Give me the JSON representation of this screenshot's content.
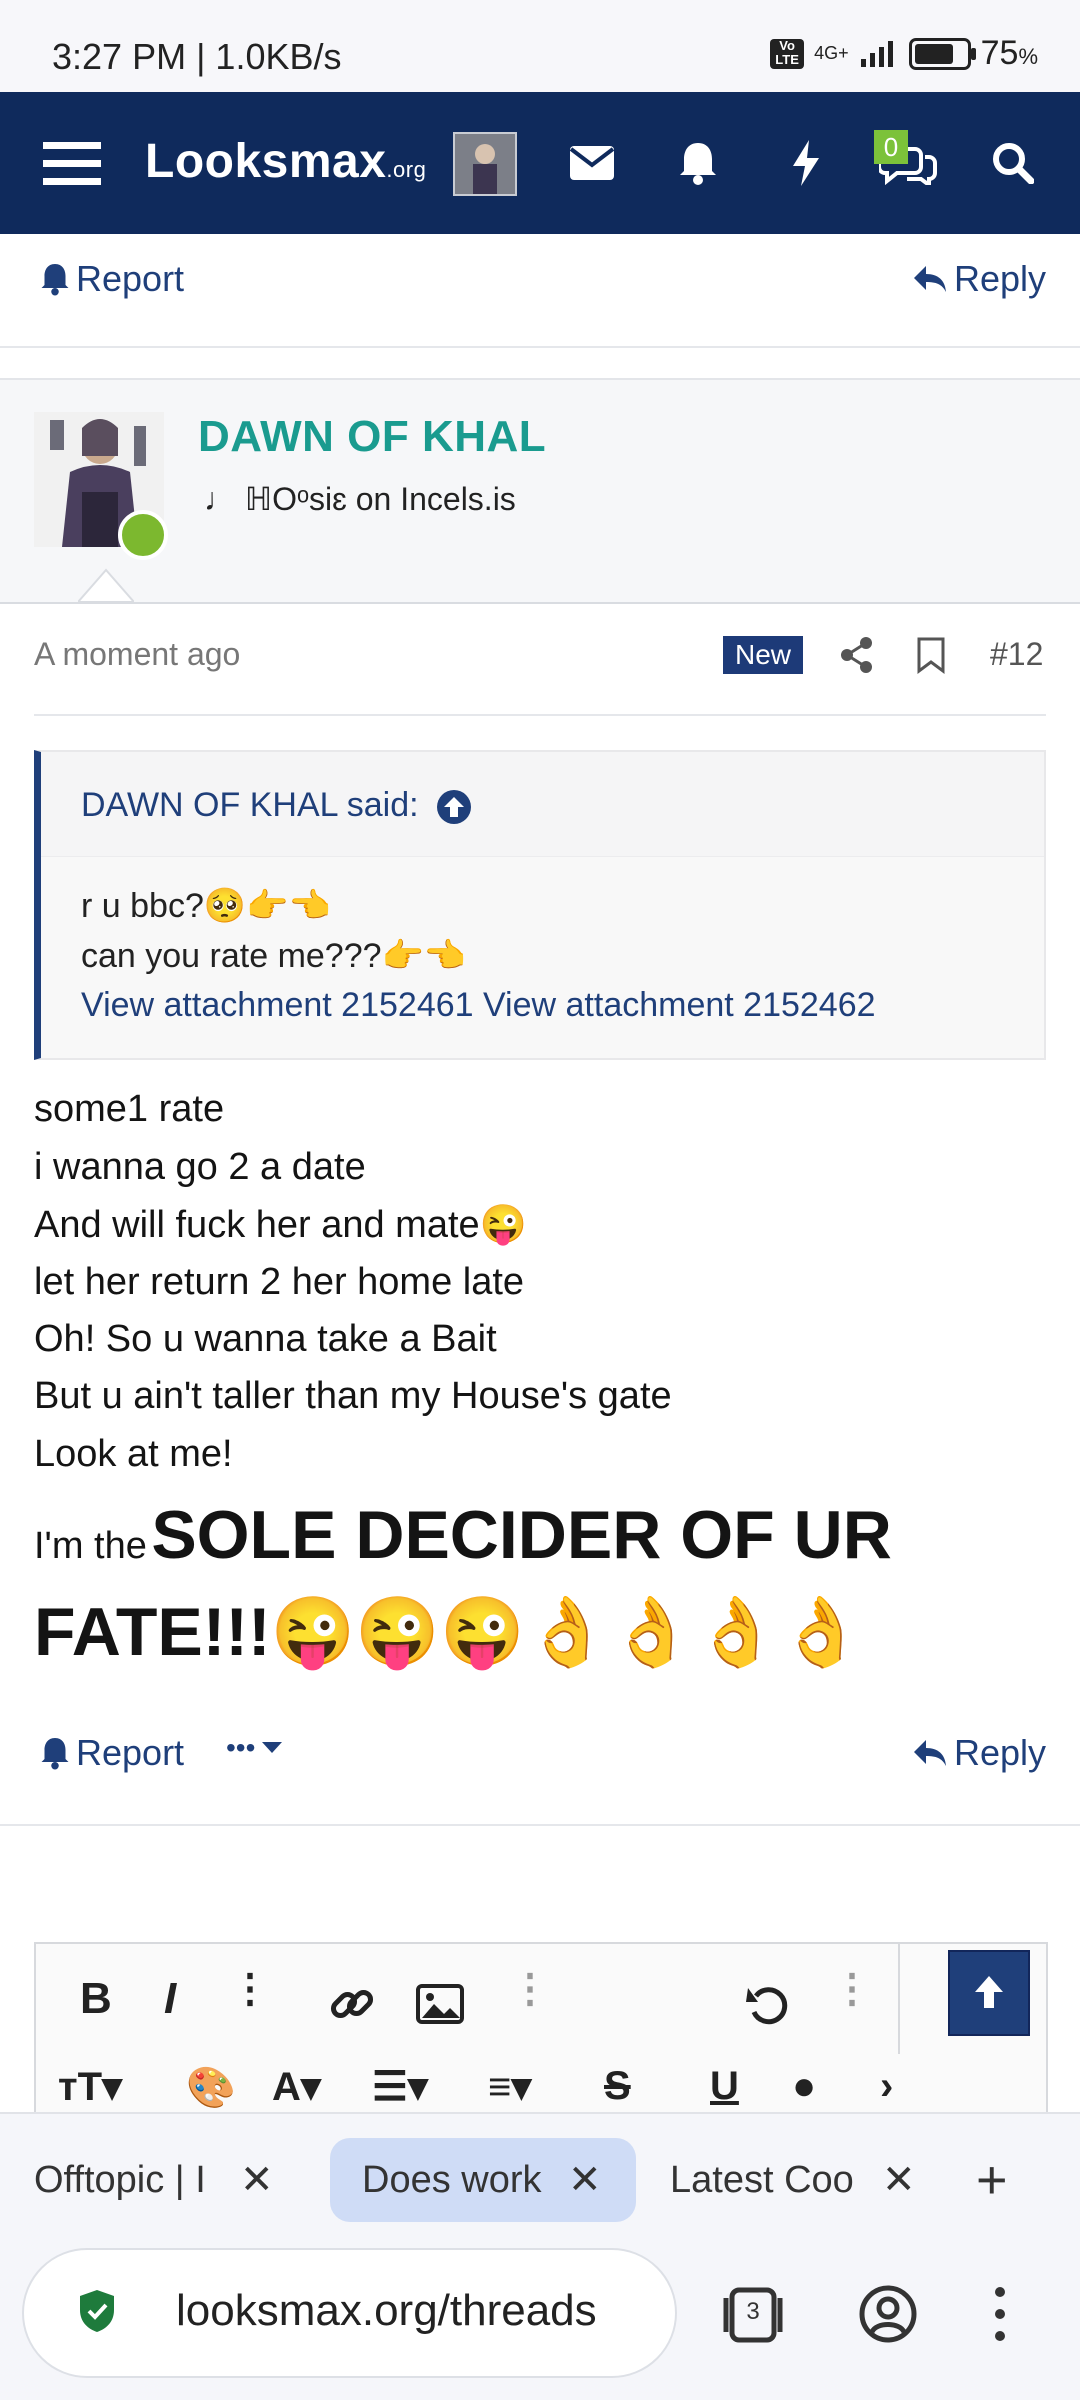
{
  "status": {
    "time": "3:27 PM | 1.0KB/s",
    "network": "4G+",
    "battery": "75"
  },
  "header": {
    "logo": "Looksmax",
    "logo_suffix": ".org",
    "conversations_badge": "0",
    "colors": {
      "bar": "#0f2a5c",
      "badge": "#7cc23a"
    }
  },
  "prev_post": {
    "report": "Report",
    "reply": "Reply"
  },
  "post": {
    "username": "DAWN OF KHAL",
    "user_title": "♩ ℍOᵒsiɛ on Incels.is",
    "time": "A moment ago",
    "new_badge": "New",
    "number": "#12",
    "quote": {
      "author": "DAWN OF KHAL said:",
      "line1": "r u bbc?🥺👉👈",
      "line2": "can you rate me???👉👈",
      "links": "View attachment 2152461 View attachment 2152462"
    },
    "lines": [
      "some1 rate",
      "i wanna go 2 a date",
      "And will fuck her and mate😜",
      "let her return 2 her home late",
      "Oh! So u wanna take a Bait",
      "But u ain't taller than my House's gate",
      "Look at me!"
    ],
    "last_prefix": "I'm the",
    "big_text_1": "SOLE DECIDER OF UR",
    "big_text_2": "FATE!!!😜😜😜👌👌👌👌",
    "report": "Report",
    "more": "•••",
    "reply": "Reply"
  },
  "browser": {
    "tabs": [
      "Offtopic | I",
      "Does work",
      "Latest Coo"
    ],
    "active_tab_index": 1,
    "url": "looksmax.org/threads",
    "tab_count": "3"
  }
}
